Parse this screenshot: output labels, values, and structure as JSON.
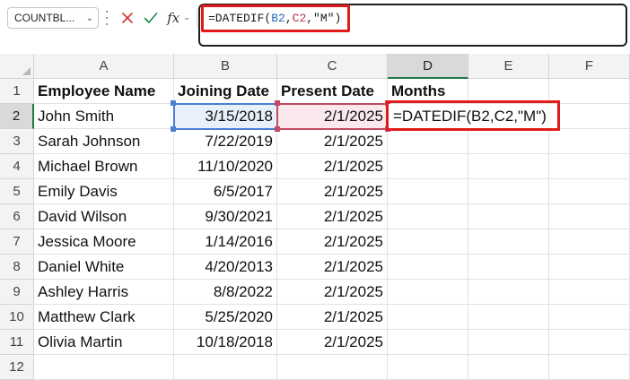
{
  "formula_bar": {
    "name_box": "COUNTBL...",
    "chevron": "⌄",
    "cancel_icon": "close-icon",
    "enter_icon": "check-icon",
    "fx_label": "fx",
    "fx_chevron": "⌄",
    "formula_prefix": "=DATEDIF(",
    "formula_ref1": "B2",
    "formula_sep1": ",",
    "formula_ref2": "C2",
    "formula_suffix": ",\"M\")",
    "colors": {
      "highlight": "#e21a1a",
      "ref_b": "#2c68b8",
      "ref_c": "#b5324a"
    }
  },
  "columns": [
    "A",
    "B",
    "C",
    "D",
    "E",
    "F"
  ],
  "active_column": "D",
  "active_row": "2",
  "row_numbers": [
    "1",
    "2",
    "3",
    "4",
    "5",
    "6",
    "7",
    "8",
    "9",
    "10",
    "11",
    "12"
  ],
  "headers": {
    "a": "Employee Name",
    "b": "Joining Date",
    "c": "Present Date",
    "d": "Months"
  },
  "rows": [
    {
      "name": "John Smith",
      "joining": "3/15/2018",
      "present": "2/1/2025"
    },
    {
      "name": "Sarah Johnson",
      "joining": "7/22/2019",
      "present": "2/1/2025"
    },
    {
      "name": "Michael Brown",
      "joining": "11/10/2020",
      "present": "2/1/2025"
    },
    {
      "name": "Emily Davis",
      "joining": "6/5/2017",
      "present": "2/1/2025"
    },
    {
      "name": "David Wilson",
      "joining": "9/30/2021",
      "present": "2/1/2025"
    },
    {
      "name": "Jessica Moore",
      "joining": "1/14/2016",
      "present": "2/1/2025"
    },
    {
      "name": "Daniel White",
      "joining": "4/20/2013",
      "present": "2/1/2025"
    },
    {
      "name": "Ashley Harris",
      "joining": "8/8/2022",
      "present": "2/1/2025"
    },
    {
      "name": "Matthew Clark",
      "joining": "5/25/2020",
      "present": "2/1/2025"
    },
    {
      "name": "Olivia Martin",
      "joining": "10/18/2018",
      "present": "2/1/2025"
    }
  ],
  "editing_cell": {
    "text": "=DATEDIF(B2,C2,\"M\")"
  }
}
